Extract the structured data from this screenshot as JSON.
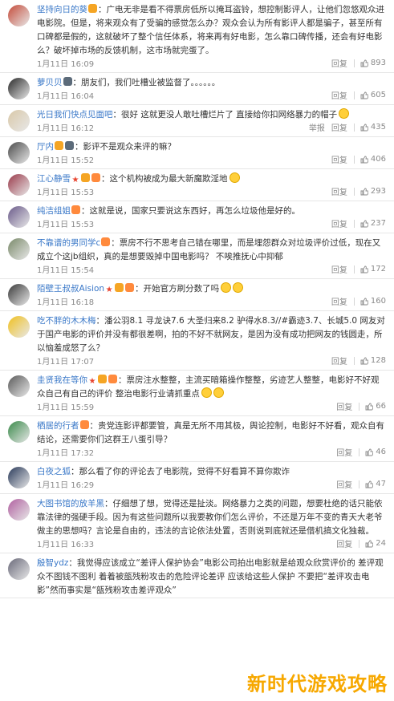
{
  "labels": {
    "reply": "回复",
    "report": "举报"
  },
  "comments": [
    {
      "user": "坚持向日的葵",
      "badges": [
        "vip"
      ],
      "text": "：广电无非是看不得票房低所以掩耳盗铃，想控制影评人，让他们忽悠观众进电影院。但是，将来观众有了受骗的感觉怎么办？观众会认为所有影评人都是骗子，甚至所有口碑都是假的，这就破坏了整个信任体系，将来再有好电影，怎么靠口碑传播，还会有好电影么？破坏掉市场的反馈机制，这市场就完蛋了。",
      "time": "1月11日 16:09",
      "likes": "893",
      "report": false,
      "avatar": "#c44b3a"
    },
    {
      "user": "萝贝贝",
      "badges": [
        "lv"
      ],
      "text": "：朋友们，我们吐槽业被监督了。。。。。。",
      "time": "1月11日 16:04",
      "likes": "605",
      "report": false,
      "avatar": "#2a2a2a"
    },
    {
      "user": "光日我们快点见面吧",
      "badges": [],
      "text": "：很好 这就更没人敢吐槽烂片了 直接给你扣网络暴力的帽子",
      "time": "1月11日 16:12",
      "likes": "435",
      "report": true,
      "avatar": "#d9c8a8",
      "emoji": 1
    },
    {
      "user": "厅内",
      "badges": [
        "vip",
        "lv"
      ],
      "text": "：影评不是观众来评的嘛？",
      "time": "1月11日 15:52",
      "likes": "406",
      "report": false,
      "avatar": "#4a4a4a"
    },
    {
      "user": "江心静雪",
      "badges": [
        "star",
        "vip",
        "gift"
      ],
      "text": "：这个机构被成为最大新魔欺淫地",
      "time": "1月11日 15:53",
      "likes": "293",
      "report": false,
      "avatar": "#9a3a4a",
      "emoji": 1
    },
    {
      "user": "纯洁组姐",
      "badges": [
        "gift"
      ],
      "text": "：这就是说，国家只要说这东西好，再怎么垃圾他是好的。",
      "time": "1月11日 15:53",
      "likes": "237",
      "report": false,
      "avatar": "#6a5a8a"
    },
    {
      "user": "不靠谱的男同学c",
      "badges": [
        "gift"
      ],
      "text": "：票房不行不思考自己错在哪里，而是埋怨群众对垃圾评价过低，现在又成立个这jb组织，真的是想要毁掉中国电影吗？ 不唉推抚心中抑郁",
      "time": "1月11日 15:54",
      "likes": "172",
      "report": false,
      "avatar": "#7a8a6a"
    },
    {
      "user": "陌壁王叔叔Aision",
      "badges": [
        "star",
        "vip",
        "gift"
      ],
      "text": "：开始官方刷分数了吗",
      "time": "1月11日 16:18",
      "likes": "160",
      "report": false,
      "avatar": "#3a3a3a",
      "emoji": 2
    },
    {
      "user": "吃不胖的木木梅",
      "badges": [],
      "text": "：潘公羽8.1 寻龙诀7.6 大圣归来8.2 驴得水8.3//#霸迹3.7、长城5.0 网友对于国产电影的评价并没有都很差啊，拍的不好不就网友，是因为没有成功把网友的钱圆走，所以恼羞成怒了么？",
      "time": "1月11日 17:07",
      "likes": "128",
      "report": false,
      "avatar": "#f0c020"
    },
    {
      "user": "圭贤我在等你",
      "badges": [
        "star",
        "vip",
        "gift"
      ],
      "text": "：票房注水整整，主流买暗箱操作整整，劣迹艺人整整，电影好不好观众自己有自己的评价 整治电影行业请抓重点",
      "time": "1月11日 15:59",
      "likes": "66",
      "report": false,
      "avatar": "#5a5a5a",
      "emoji": 2
    },
    {
      "user": "栖居的行者",
      "badges": [
        "gift"
      ],
      "text": "：贵党连影评都要管，真是无所不用其极，舆论控制，电影好不好看，观众自有结论，还需要你们这群王八蛋引导？",
      "time": "1月11日 17:32",
      "likes": "46",
      "report": false,
      "avatar": "#3a8a4a"
    },
    {
      "user": "白夜之狐",
      "badges": [],
      "text": "：那么看了你的评论去了电影院，觉得不好看算不算你欺诈",
      "time": "1月11日 16:29",
      "likes": "47",
      "report": false,
      "avatar": "#2a3a5a"
    },
    {
      "user": "大图书馆的放羊黑",
      "badges": [],
      "text": "：仔细想了想，觉得还是扯淡。网络暴力之类的问题，想要杜绝的话只能依靠法律的强硬手段。因为有这些问题所以我要教你们怎么评价，不还是万年不变的青天大老爷做主的思想吗？言论是自由的，违法的言论依法处置，否则说到底就还是借机搞文化独裁。",
      "time": "1月11日 16:33",
      "likes": "24",
      "report": false,
      "avatar": "#b060a0"
    },
    {
      "user": "殷智ydz",
      "badges": [],
      "text": "：我觉得应该成立“差评人保护协会”电影公司拍出电影就是给观众欣赏评价的 差评观众不图钱不图利 着着被瓿残粉攻击的危险评论差评 应该给这些人保护 不要把“差评攻击电影”然而事实是“瓿残粉攻击差评观众”",
      "time": "",
      "likes": "",
      "report": false,
      "avatar": "#6a6a7a"
    }
  ],
  "watermark": "新时代游戏攻略"
}
